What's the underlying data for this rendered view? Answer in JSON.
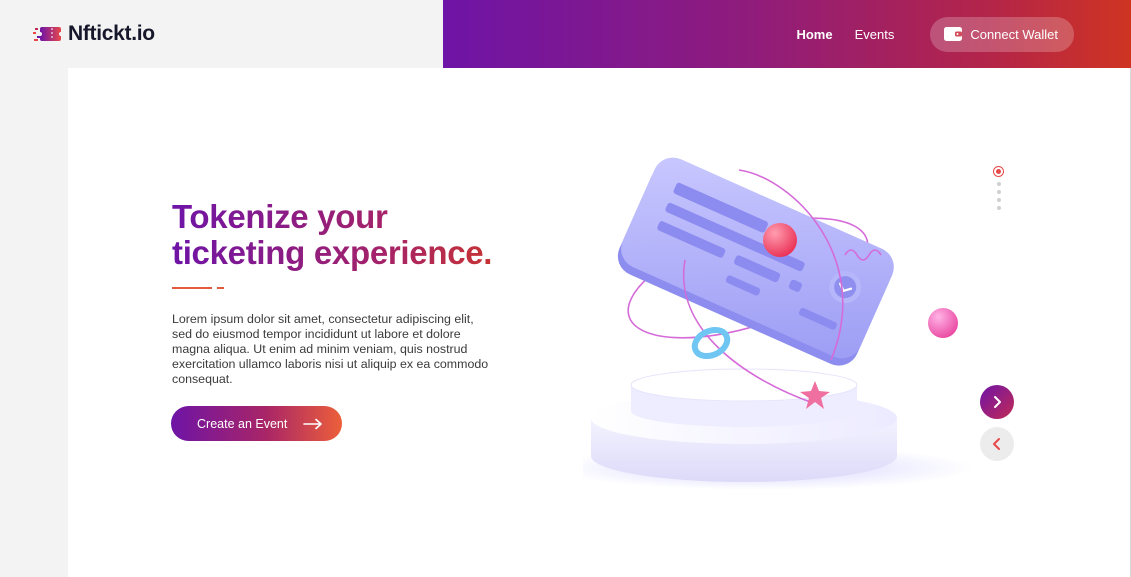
{
  "brand": {
    "name": "Nftickt.io",
    "logo_icon": "ticket-logo-icon",
    "logo_colors": [
      "#6e14a6",
      "#c22a55",
      "#e8484a"
    ]
  },
  "nav": {
    "links": [
      {
        "label": "Home",
        "active": true
      },
      {
        "label": "Events",
        "active": false
      }
    ],
    "wallet_button": {
      "label": "Connect Wallet",
      "icon": "wallet-icon"
    },
    "gradient": [
      "#6e14a6",
      "#cf3422"
    ]
  },
  "hero": {
    "title_line1": "Tokenize your",
    "title_line2": "ticketing experience.",
    "body": "Lorem ipsum dolor sit amet, consectetur adipiscing elit, sed do eiusmod tempor incididunt ut labore et dolore magna aliqua. Ut enim ad minim veniam, quis nostrud exercitation ullamco laboris nisi ut aliquip ex ea commodo consequat.",
    "cta_label": "Create an Event",
    "cta_icon": "arrow-right-icon"
  },
  "slider": {
    "total_slides": 4,
    "active_slide": 1,
    "next_icon": "chevron-right-icon",
    "prev_icon": "chevron-left-icon"
  },
  "colors": {
    "accent_purple": "#6e14a6",
    "accent_red": "#e8484a",
    "background": "#f3f3f3",
    "card": "#ffffff"
  }
}
